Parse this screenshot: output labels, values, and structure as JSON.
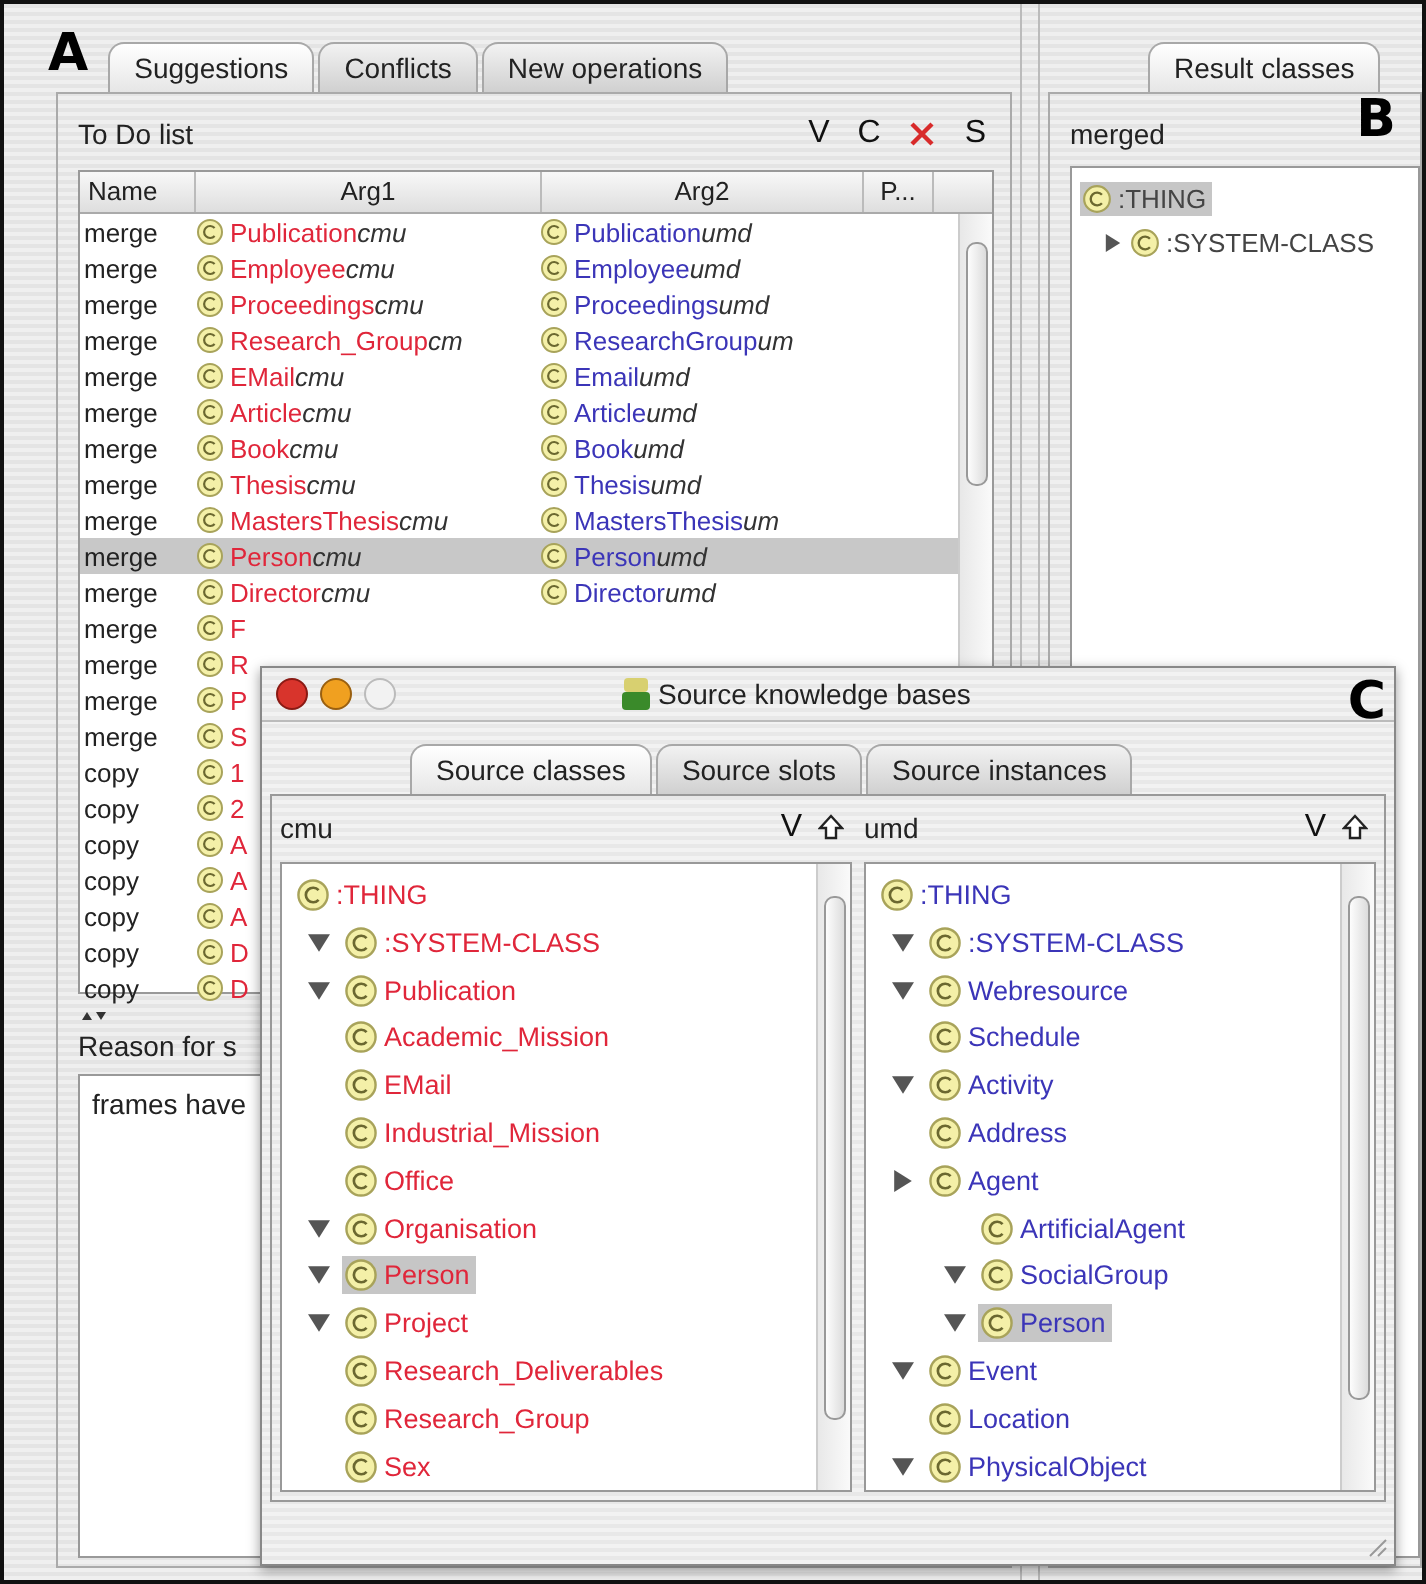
{
  "main_window": {
    "left_pane": {
      "marker": "A",
      "tabs": [
        {
          "label": "Suggestions",
          "selected": true
        },
        {
          "label": "Conflicts",
          "selected": false
        },
        {
          "label": "New operations",
          "selected": false
        }
      ],
      "todo": {
        "title": "To Do list",
        "tools": [
          {
            "kind": "text",
            "label": "V"
          },
          {
            "kind": "text",
            "label": "C"
          },
          {
            "kind": "delete"
          },
          {
            "kind": "text",
            "label": "S"
          }
        ],
        "columns": [
          {
            "label": "Name"
          },
          {
            "label": "Arg1",
            "color": "#e0263a"
          },
          {
            "label": "Arg2",
            "color": "#3b35b8"
          },
          {
            "label": "P..."
          }
        ],
        "rows": [
          {
            "name": "merge",
            "arg1": "Publication",
            "arg1_source": "cmu",
            "arg2": "Publication",
            "arg2_source": "umd",
            "selected": false
          },
          {
            "name": "merge",
            "arg1": "Employee",
            "arg1_source": "cmu",
            "arg2": "Employee",
            "arg2_source": "umd",
            "selected": false
          },
          {
            "name": "merge",
            "arg1": "Proceedings",
            "arg1_source": "cmu",
            "arg2": "Proceedings",
            "arg2_source": "umd",
            "selected": false
          },
          {
            "name": "merge",
            "arg1": "Research_Group",
            "arg1_source": "cm",
            "arg2": "ResearchGroup",
            "arg2_source": "um",
            "selected": false
          },
          {
            "name": "merge",
            "arg1": "EMail",
            "arg1_source": "cmu",
            "arg2": "Email",
            "arg2_source": "umd",
            "selected": false
          },
          {
            "name": "merge",
            "arg1": "Article",
            "arg1_source": "cmu",
            "arg2": "Article",
            "arg2_source": "umd",
            "selected": false
          },
          {
            "name": "merge",
            "arg1": "Book",
            "arg1_source": "cmu",
            "arg2": "Book",
            "arg2_source": "umd",
            "selected": false
          },
          {
            "name": "merge",
            "arg1": "Thesis",
            "arg1_source": "cmu",
            "arg2": "Thesis",
            "arg2_source": "umd",
            "selected": false
          },
          {
            "name": "merge",
            "arg1": "MastersThesis",
            "arg1_source": "cmu",
            "arg2": "MastersThesis",
            "arg2_source": "um",
            "selected": false
          },
          {
            "name": "merge",
            "arg1": "Person",
            "arg1_source": "cmu",
            "arg2": "Person",
            "arg2_source": "umd",
            "selected": true
          },
          {
            "name": "merge",
            "arg1": "Director",
            "arg1_source": "cmu",
            "arg2": "Director",
            "arg2_source": "umd",
            "selected": false
          },
          {
            "name": "merge",
            "arg1": "F",
            "selected": false
          },
          {
            "name": "merge",
            "arg1": "R",
            "selected": false
          },
          {
            "name": "merge",
            "arg1": "P",
            "selected": false
          },
          {
            "name": "merge",
            "arg1": "S",
            "selected": false
          },
          {
            "name": "copy",
            "arg1": "1",
            "selected": false
          },
          {
            "name": "copy",
            "arg1": "2",
            "selected": false
          },
          {
            "name": "copy",
            "arg1": "A",
            "selected": false
          },
          {
            "name": "copy",
            "arg1": "A",
            "selected": false
          },
          {
            "name": "copy",
            "arg1": "A",
            "selected": false
          },
          {
            "name": "copy",
            "arg1": "D",
            "selected": false
          },
          {
            "name": "copy",
            "arg1": "D",
            "selected": false
          }
        ]
      },
      "reason": {
        "label": "Reason for s",
        "text": "frames have"
      }
    },
    "right_pane": {
      "marker": "B",
      "tabs": [
        {
          "label": "Result classes",
          "selected": true
        }
      ],
      "title": "merged",
      "tree": [
        {
          "label": ":THING",
          "selected": true,
          "children": [
            {
              "label": ":SYSTEM-CLASS",
              "expanded": false,
              "selected": false
            }
          ]
        }
      ]
    }
  },
  "source_window": {
    "marker": "C",
    "title": "Source knowledge bases",
    "tabs": [
      {
        "label": "Source classes",
        "selected": true
      },
      {
        "label": "Source slots",
        "selected": false
      },
      {
        "label": "Source instances",
        "selected": false
      }
    ],
    "panes": [
      {
        "title": "cmu",
        "tool": "V",
        "color": "#e0263a",
        "tree": [
          {
            "label": ":THING",
            "selected": false,
            "children": [
              {
                "label": ":SYSTEM-CLASS",
                "expanded": true,
                "selected": false
              },
              {
                "label": "Publication",
                "expanded": true,
                "selected": false
              },
              {
                "label": "Academic_Mission",
                "selected": false
              },
              {
                "label": "EMail",
                "selected": false
              },
              {
                "label": "Industrial_Mission",
                "selected": false
              },
              {
                "label": "Office",
                "selected": false
              },
              {
                "label": "Organisation",
                "expanded": true,
                "selected": false
              },
              {
                "label": "Person",
                "expanded": true,
                "selected": true
              },
              {
                "label": "Project",
                "expanded": true,
                "selected": false
              },
              {
                "label": "Research_Deliverables",
                "selected": false
              },
              {
                "label": "Research_Group",
                "selected": false
              },
              {
                "label": "Sex",
                "selected": false
              }
            ]
          }
        ]
      },
      {
        "title": "umd",
        "tool": "V",
        "color": "#3b35b8",
        "tree": [
          {
            "label": ":THING",
            "selected": false,
            "children": [
              {
                "label": ":SYSTEM-CLASS",
                "expanded": true,
                "selected": false
              },
              {
                "label": "Webresource",
                "expanded": true,
                "selected": false
              },
              {
                "label": "Schedule",
                "selected": false
              },
              {
                "label": "Activity",
                "expanded": true,
                "selected": false
              },
              {
                "label": "Address",
                "selected": false
              },
              {
                "label": "Agent",
                "expanded": false,
                "selected": false,
                "children": [
                  {
                    "label": "ArtificialAgent",
                    "selected": false
                  },
                  {
                    "label": "SocialGroup",
                    "expanded": true,
                    "selected": false
                  },
                  {
                    "label": "Person",
                    "expanded": true,
                    "selected": true
                  }
                ]
              },
              {
                "label": "Event",
                "expanded": true,
                "selected": false
              },
              {
                "label": "Location",
                "selected": false
              },
              {
                "label": "PhysicalObject",
                "expanded": true,
                "selected": false
              }
            ]
          }
        ]
      }
    ]
  }
}
